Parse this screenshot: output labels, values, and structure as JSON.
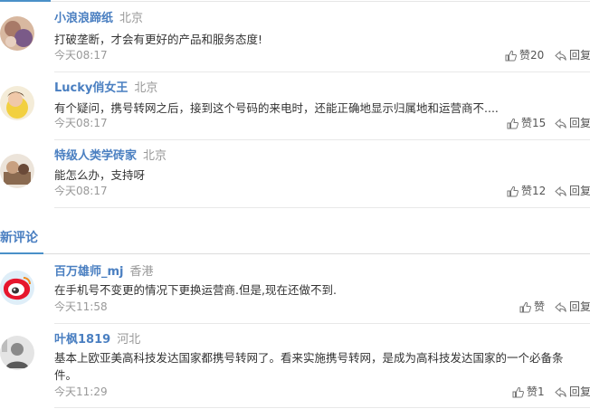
{
  "hot_comments": [
    {
      "user": "小浪浪蹄纸",
      "location": "北京",
      "text": "打破垄断，才会有更好的产品和服务态度!",
      "time": "今天08:17",
      "likes": "赞20",
      "reply": "回复",
      "avatar": "photo-avatar"
    },
    {
      "user": "Lucky俏女王",
      "location": "北京",
      "text": "有个疑问，携号转网之后，接到这个号码的来电时，还能正确地显示归属地和运营商不....",
      "time": "今天08:17",
      "likes": "赞15",
      "reply": "回复",
      "avatar": "photo-avatar"
    },
    {
      "user": "特级人类学砖家",
      "location": "北京",
      "text": "能怎么办，支持呀",
      "time": "今天08:17",
      "likes": "赞12",
      "reply": "回复",
      "avatar": "photo-avatar"
    }
  ],
  "new_comments_title": "新评论",
  "new_comments": [
    {
      "user": "百万雄师_mj",
      "location": "香港",
      "text": "在手机号不变更的情况下更换运营商.但是,现在还做不到.",
      "time": "今天11:58",
      "likes": "赞",
      "reply": "回复",
      "avatar": "weibo-default-avatar"
    },
    {
      "user": "叶枫1819",
      "location": "河北",
      "text_line1": "基本上欧亚美高科技发达国家都携号转网了。看来实施携号转网，是成为高科技发达国家的一个必备条",
      "text_line2": "件。",
      "time": "今天11:29",
      "likes": "赞1",
      "reply": "回复",
      "avatar": "photo-avatar"
    }
  ],
  "icons": {
    "like": "thumbs-up-icon",
    "reply": "reply-arrow-icon"
  },
  "colors": {
    "username": "#4a7fc1",
    "meta": "#999999",
    "accent": "#4a90c8"
  }
}
